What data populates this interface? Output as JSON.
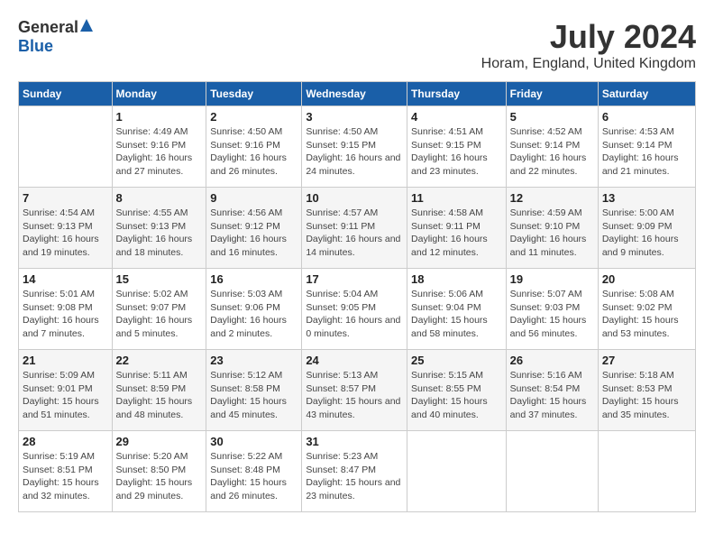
{
  "logo": {
    "general": "General",
    "blue": "Blue"
  },
  "title": "July 2024",
  "subtitle": "Horam, England, United Kingdom",
  "days_of_week": [
    "Sunday",
    "Monday",
    "Tuesday",
    "Wednesday",
    "Thursday",
    "Friday",
    "Saturday"
  ],
  "weeks": [
    [
      {
        "day": "",
        "sunrise": "",
        "sunset": "",
        "daylight": ""
      },
      {
        "day": "1",
        "sunrise": "Sunrise: 4:49 AM",
        "sunset": "Sunset: 9:16 PM",
        "daylight": "Daylight: 16 hours and 27 minutes."
      },
      {
        "day": "2",
        "sunrise": "Sunrise: 4:50 AM",
        "sunset": "Sunset: 9:16 PM",
        "daylight": "Daylight: 16 hours and 26 minutes."
      },
      {
        "day": "3",
        "sunrise": "Sunrise: 4:50 AM",
        "sunset": "Sunset: 9:15 PM",
        "daylight": "Daylight: 16 hours and 24 minutes."
      },
      {
        "day": "4",
        "sunrise": "Sunrise: 4:51 AM",
        "sunset": "Sunset: 9:15 PM",
        "daylight": "Daylight: 16 hours and 23 minutes."
      },
      {
        "day": "5",
        "sunrise": "Sunrise: 4:52 AM",
        "sunset": "Sunset: 9:14 PM",
        "daylight": "Daylight: 16 hours and 22 minutes."
      },
      {
        "day": "6",
        "sunrise": "Sunrise: 4:53 AM",
        "sunset": "Sunset: 9:14 PM",
        "daylight": "Daylight: 16 hours and 21 minutes."
      }
    ],
    [
      {
        "day": "7",
        "sunrise": "Sunrise: 4:54 AM",
        "sunset": "Sunset: 9:13 PM",
        "daylight": "Daylight: 16 hours and 19 minutes."
      },
      {
        "day": "8",
        "sunrise": "Sunrise: 4:55 AM",
        "sunset": "Sunset: 9:13 PM",
        "daylight": "Daylight: 16 hours and 18 minutes."
      },
      {
        "day": "9",
        "sunrise": "Sunrise: 4:56 AM",
        "sunset": "Sunset: 9:12 PM",
        "daylight": "Daylight: 16 hours and 16 minutes."
      },
      {
        "day": "10",
        "sunrise": "Sunrise: 4:57 AM",
        "sunset": "Sunset: 9:11 PM",
        "daylight": "Daylight: 16 hours and 14 minutes."
      },
      {
        "day": "11",
        "sunrise": "Sunrise: 4:58 AM",
        "sunset": "Sunset: 9:11 PM",
        "daylight": "Daylight: 16 hours and 12 minutes."
      },
      {
        "day": "12",
        "sunrise": "Sunrise: 4:59 AM",
        "sunset": "Sunset: 9:10 PM",
        "daylight": "Daylight: 16 hours and 11 minutes."
      },
      {
        "day": "13",
        "sunrise": "Sunrise: 5:00 AM",
        "sunset": "Sunset: 9:09 PM",
        "daylight": "Daylight: 16 hours and 9 minutes."
      }
    ],
    [
      {
        "day": "14",
        "sunrise": "Sunrise: 5:01 AM",
        "sunset": "Sunset: 9:08 PM",
        "daylight": "Daylight: 16 hours and 7 minutes."
      },
      {
        "day": "15",
        "sunrise": "Sunrise: 5:02 AM",
        "sunset": "Sunset: 9:07 PM",
        "daylight": "Daylight: 16 hours and 5 minutes."
      },
      {
        "day": "16",
        "sunrise": "Sunrise: 5:03 AM",
        "sunset": "Sunset: 9:06 PM",
        "daylight": "Daylight: 16 hours and 2 minutes."
      },
      {
        "day": "17",
        "sunrise": "Sunrise: 5:04 AM",
        "sunset": "Sunset: 9:05 PM",
        "daylight": "Daylight: 16 hours and 0 minutes."
      },
      {
        "day": "18",
        "sunrise": "Sunrise: 5:06 AM",
        "sunset": "Sunset: 9:04 PM",
        "daylight": "Daylight: 15 hours and 58 minutes."
      },
      {
        "day": "19",
        "sunrise": "Sunrise: 5:07 AM",
        "sunset": "Sunset: 9:03 PM",
        "daylight": "Daylight: 15 hours and 56 minutes."
      },
      {
        "day": "20",
        "sunrise": "Sunrise: 5:08 AM",
        "sunset": "Sunset: 9:02 PM",
        "daylight": "Daylight: 15 hours and 53 minutes."
      }
    ],
    [
      {
        "day": "21",
        "sunrise": "Sunrise: 5:09 AM",
        "sunset": "Sunset: 9:01 PM",
        "daylight": "Daylight: 15 hours and 51 minutes."
      },
      {
        "day": "22",
        "sunrise": "Sunrise: 5:11 AM",
        "sunset": "Sunset: 8:59 PM",
        "daylight": "Daylight: 15 hours and 48 minutes."
      },
      {
        "day": "23",
        "sunrise": "Sunrise: 5:12 AM",
        "sunset": "Sunset: 8:58 PM",
        "daylight": "Daylight: 15 hours and 45 minutes."
      },
      {
        "day": "24",
        "sunrise": "Sunrise: 5:13 AM",
        "sunset": "Sunset: 8:57 PM",
        "daylight": "Daylight: 15 hours and 43 minutes."
      },
      {
        "day": "25",
        "sunrise": "Sunrise: 5:15 AM",
        "sunset": "Sunset: 8:55 PM",
        "daylight": "Daylight: 15 hours and 40 minutes."
      },
      {
        "day": "26",
        "sunrise": "Sunrise: 5:16 AM",
        "sunset": "Sunset: 8:54 PM",
        "daylight": "Daylight: 15 hours and 37 minutes."
      },
      {
        "day": "27",
        "sunrise": "Sunrise: 5:18 AM",
        "sunset": "Sunset: 8:53 PM",
        "daylight": "Daylight: 15 hours and 35 minutes."
      }
    ],
    [
      {
        "day": "28",
        "sunrise": "Sunrise: 5:19 AM",
        "sunset": "Sunset: 8:51 PM",
        "daylight": "Daylight: 15 hours and 32 minutes."
      },
      {
        "day": "29",
        "sunrise": "Sunrise: 5:20 AM",
        "sunset": "Sunset: 8:50 PM",
        "daylight": "Daylight: 15 hours and 29 minutes."
      },
      {
        "day": "30",
        "sunrise": "Sunrise: 5:22 AM",
        "sunset": "Sunset: 8:48 PM",
        "daylight": "Daylight: 15 hours and 26 minutes."
      },
      {
        "day": "31",
        "sunrise": "Sunrise: 5:23 AM",
        "sunset": "Sunset: 8:47 PM",
        "daylight": "Daylight: 15 hours and 23 minutes."
      },
      {
        "day": "",
        "sunrise": "",
        "sunset": "",
        "daylight": ""
      },
      {
        "day": "",
        "sunrise": "",
        "sunset": "",
        "daylight": ""
      },
      {
        "day": "",
        "sunrise": "",
        "sunset": "",
        "daylight": ""
      }
    ]
  ]
}
